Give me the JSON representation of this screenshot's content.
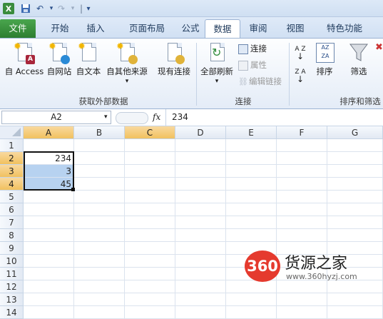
{
  "quick_access": {
    "separator": "|",
    "customize": "▾"
  },
  "tabs": [
    {
      "label": "文件"
    },
    {
      "label": "开始"
    },
    {
      "label": "插入"
    },
    {
      "label": "页面布局"
    },
    {
      "label": "公式"
    },
    {
      "label": "数据"
    },
    {
      "label": "审阅"
    },
    {
      "label": "视图"
    },
    {
      "label": "特色功能"
    }
  ],
  "ribbon": {
    "get_external": {
      "btn_access": "自 Access",
      "btn_web": "自网站",
      "btn_text": "自文本",
      "btn_other": "自其他来源",
      "btn_existing": "现有连接",
      "badge_access": "A",
      "group_label": "获取外部数据"
    },
    "connections": {
      "btn_refresh": "全部刷新",
      "link_connections": "连接",
      "link_properties": "属性",
      "link_edit_links": "编辑链接",
      "group_label": "连接"
    },
    "sort_filter": {
      "sort_az": "A Z",
      "sort_za": "Z A",
      "btn_sort": "排序",
      "btn_filter": "筛选",
      "group_label": "排序和筛选"
    }
  },
  "formula_bar": {
    "name_box": "A2",
    "fx": "fx",
    "value": "234"
  },
  "columns": [
    "A",
    "B",
    "C",
    "D",
    "E",
    "F",
    "G"
  ],
  "rows": [
    "1",
    "2",
    "3",
    "4",
    "5",
    "6",
    "7",
    "8",
    "9",
    "10",
    "11",
    "12",
    "13",
    "14"
  ],
  "cells": {
    "A2": "234",
    "A3": "3",
    "A4": "45"
  },
  "watermark": {
    "logo": "360",
    "title": "货源之家",
    "url": "www.360hyzj.com"
  },
  "colors": {
    "accent_file_tab": "#2c7e30",
    "selection_fill": "#b7d2f0",
    "header_selected": "#f1c15f",
    "watermark_red": "#e53a2e"
  }
}
